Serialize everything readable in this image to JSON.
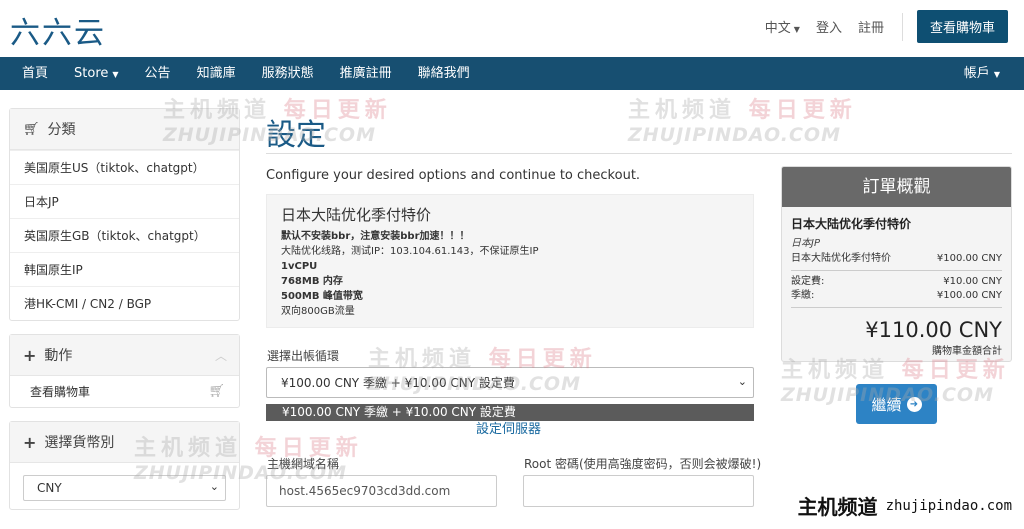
{
  "brand": {
    "logo": "六六云"
  },
  "top_links": {
    "language": "中文",
    "login": "登入",
    "register": "註冊",
    "view_cart": "查看購物車"
  },
  "nav": {
    "items": [
      "首頁",
      "Store",
      "公告",
      "知識庫",
      "服務狀態",
      "推廣註冊",
      "聯絡我們"
    ],
    "account": "帳戶"
  },
  "sidebar": {
    "categories_title": "分類",
    "categories": [
      "美国原生US（tiktok、chatgpt）",
      "日本JP",
      "英国原生GB（tiktok、chatgpt）",
      "韩国原生IP",
      "港HK-CMI / CN2 / BGP"
    ],
    "actions_title": "動作",
    "actions": [
      "查看購物車"
    ],
    "currency_title": "選擇貨幣別",
    "currency_value": "CNY"
  },
  "main": {
    "title": "設定",
    "intro": "Configure your desired options and continue to checkout.",
    "product": {
      "name": "日本大陆优化季付特价",
      "lines": [
        {
          "text": "默认不安装bbr，注意安装bbr加速！！！",
          "bold": true
        },
        {
          "text": "大陆优化线路，测试IP：103.104.61.143，不保证原生IP",
          "bold": false
        },
        {
          "text": "1vCPU",
          "bold": true
        },
        {
          "text": "768MB 内存",
          "bold": true
        },
        {
          "text": "500MB 峰值带宽",
          "bold": true
        },
        {
          "text": "双向800GB流量",
          "bold": false
        }
      ]
    },
    "billing_label": "選擇出帳循環",
    "billing_value": "¥100.00 CNY 季繳 + ¥10.00 CNY 設定費",
    "billing_option_highlight": "¥100.00 CNY 季繳 + ¥10.00 CNY 設定費",
    "configure_server_link": "設定伺服器",
    "hostname_label": "主機網域名稱",
    "hostname_value": "host.4565ec9703cd3dd.com",
    "root_label": "Root 密碼(使用高強度密码，否则会被爆破!)",
    "root_value": ""
  },
  "summary": {
    "title": "訂單概觀",
    "product": "日本大陆优化季付特价",
    "group": "日本JP",
    "rows_top": [
      {
        "label": "日本大陆优化季付特价",
        "value": "¥100.00 CNY"
      }
    ],
    "rows_bottom": [
      {
        "label": "設定費:",
        "value": "¥10.00 CNY"
      },
      {
        "label": "季繳:",
        "value": "¥100.00 CNY"
      }
    ],
    "total": "¥110.00 CNY",
    "total_label": "購物車金額合計",
    "continue": "繼續"
  },
  "watermark": {
    "cn_gray": "主机频道",
    "cn_pink": "每日更新",
    "en": "ZHUJIPINDAO.COM"
  },
  "bottom_brand": {
    "cn": "主机频道",
    "en": "zhujipindao.com"
  },
  "colors": {
    "primary": "#174f71",
    "accent": "#2d83c5",
    "title": "#1a5a86"
  }
}
